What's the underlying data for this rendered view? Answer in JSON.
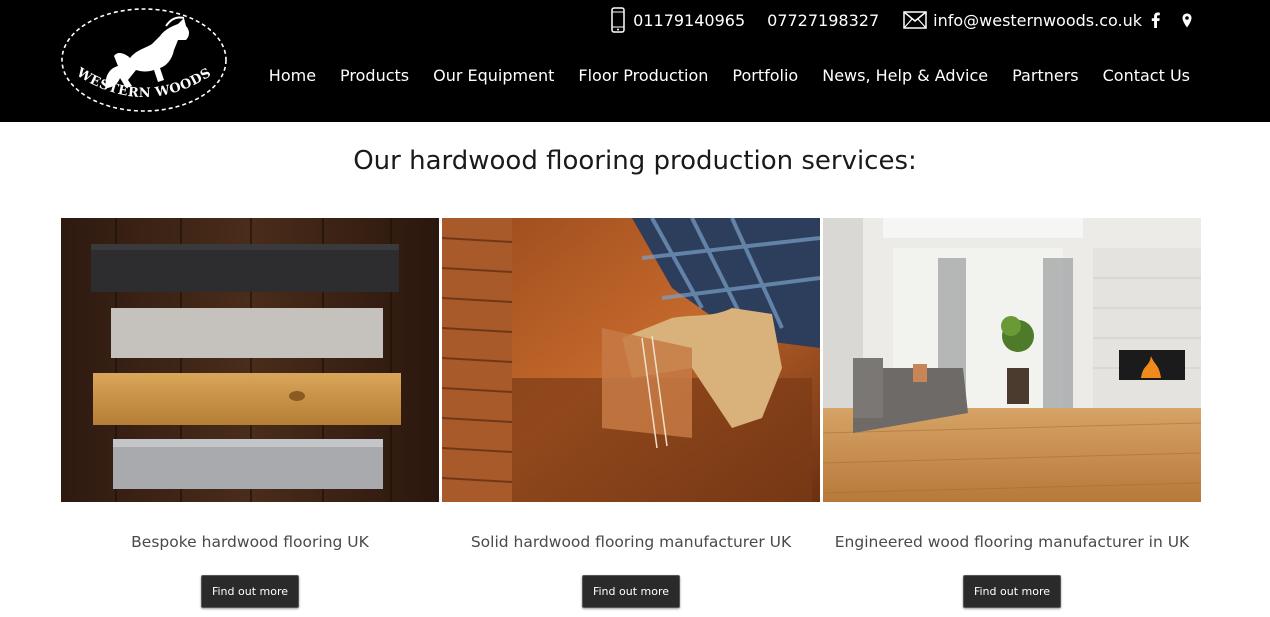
{
  "brand": {
    "logo_text": "WESTERN WOODS"
  },
  "contact": {
    "phone1": "01179140965",
    "phone2": "07727198327",
    "email": "info@westernwoods.co.uk"
  },
  "nav": [
    "Home",
    "Products",
    "Our Equipment",
    "Floor Production",
    "Portfolio",
    "News, Help & Advice",
    "Partners",
    "Contact Us"
  ],
  "heading": "Our hardwood flooring production services:",
  "services": [
    {
      "caption": "Bespoke hardwood flooring UK",
      "button": "Find out more"
    },
    {
      "caption": "Solid hardwood flooring manufacturer UK",
      "button": "Find out more"
    },
    {
      "caption": "Engineered wood flooring manufacturer in UK",
      "button": "Find out more"
    }
  ],
  "colors": {
    "header_bg": "#000000",
    "button_bg": "#2a2a2a",
    "page_bg": "#ffffff"
  },
  "icons": [
    "mobile-phone-icon",
    "envelope-icon",
    "facebook-icon",
    "map-pin-icon"
  ]
}
